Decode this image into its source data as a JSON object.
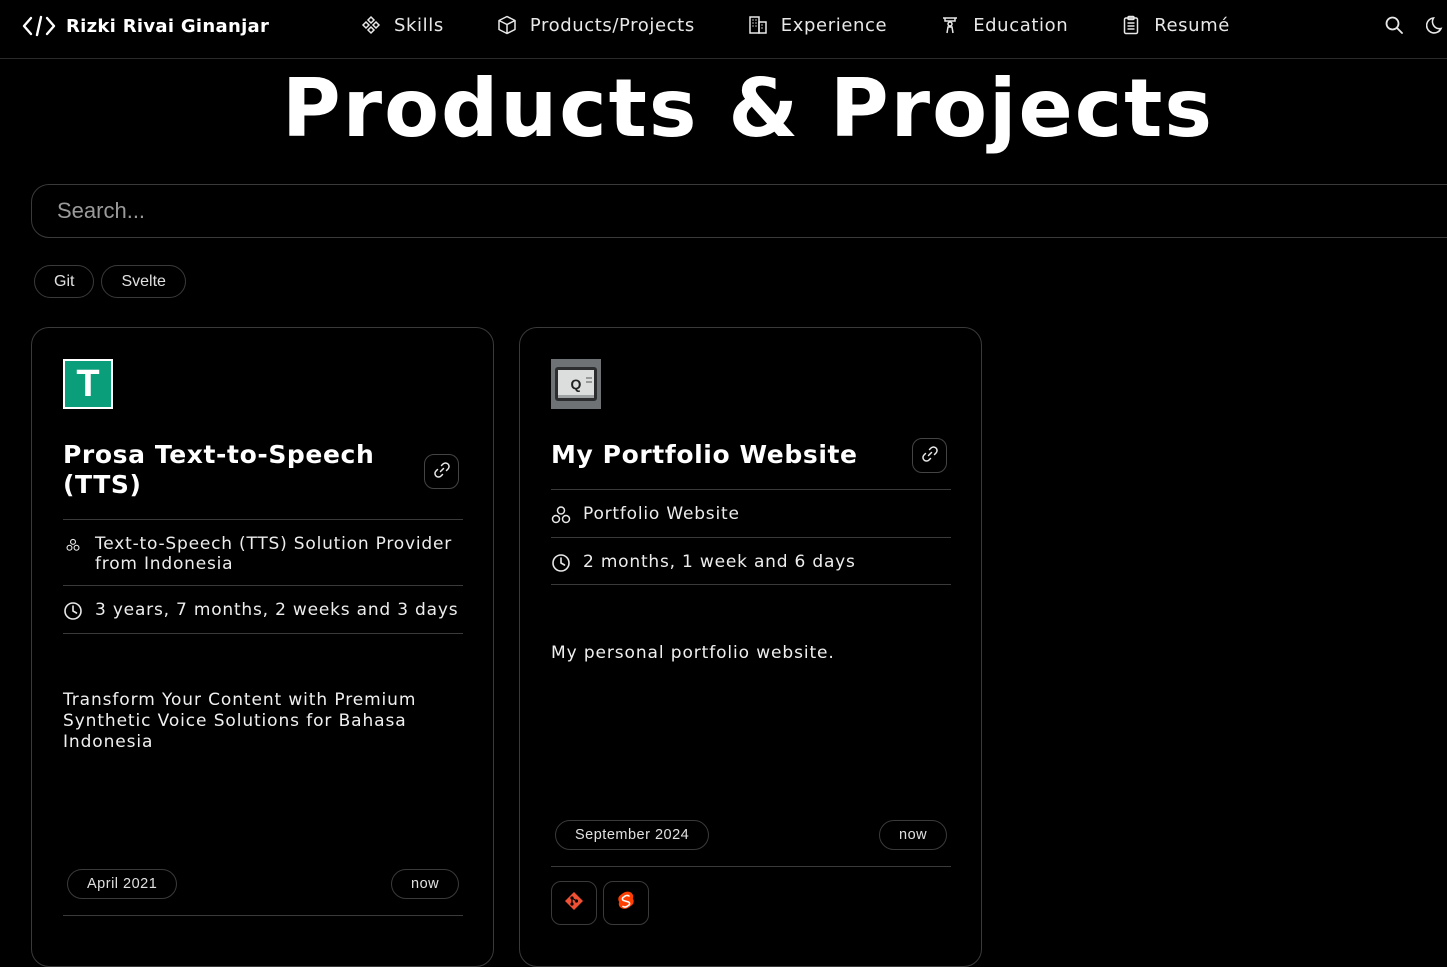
{
  "header": {
    "brand": "Rizki Rivai Ginanjar",
    "nav": [
      {
        "label": "Skills",
        "icon": "skills-icon"
      },
      {
        "label": "Products/Projects",
        "icon": "cube-icon"
      },
      {
        "label": "Experience",
        "icon": "building-icon"
      },
      {
        "label": "Education",
        "icon": "podium-icon"
      },
      {
        "label": "Resumé",
        "icon": "clipboard-icon"
      }
    ],
    "actions": [
      "search-icon",
      "moon-icon"
    ]
  },
  "page": {
    "title": "Products & Projects",
    "search_placeholder": "Search...",
    "filters": [
      "Git",
      "Svelte"
    ]
  },
  "cards": [
    {
      "logo_letter": "T",
      "title": "Prosa Text-to-Speech (TTS)",
      "category": "Text-to-Speech (TTS) Solution Provider from Indonesia",
      "duration": "3 years, 7 months, 2 weeks and 3 days",
      "description": "Transform Your Content with Premium Synthetic Voice Solutions for Bahasa Indonesia",
      "start": "April 2021",
      "end": "now",
      "tech": []
    },
    {
      "logo_letter": "Q",
      "title": "My Portfolio Website",
      "category": "Portfolio Website",
      "duration": "2 months, 1 week and 6 days",
      "description": "My personal portfolio website.",
      "start": "September 2024",
      "end": "now",
      "tech": [
        "git-icon",
        "svelte-icon"
      ]
    }
  ],
  "colors": {
    "background": "#000000",
    "border": "#3a3a3a",
    "tts_logo": "#0b9e7a",
    "git": "#f05033",
    "svelte": "#ff3e00"
  }
}
